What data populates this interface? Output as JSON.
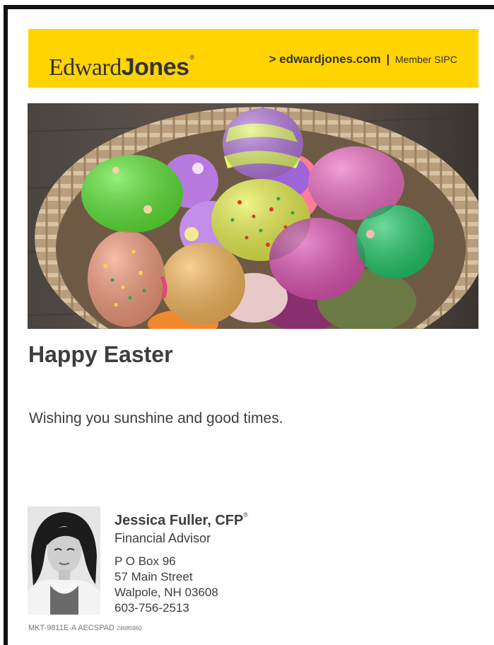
{
  "header": {
    "logo_edward": "Edward",
    "logo_jones": "Jones",
    "logo_mark": "®",
    "link_prefix": ">",
    "link_text": "edwardjones.com",
    "separator": "|",
    "member_text": "Member SIPC",
    "bar_color": "#FFD400"
  },
  "hero": {
    "icon": "easter-eggs-basket-photo"
  },
  "content": {
    "headline": "Happy Easter",
    "message": "Wishing you sunshine and good times."
  },
  "advisor": {
    "name": "Jessica Fuller, CFP",
    "name_mark": "®",
    "title": "Financial Advisor",
    "address_lines": [
      "P O Box 96",
      "57 Main Street",
      "Walpole, NH 03608",
      "603-756-2513"
    ]
  },
  "footer": {
    "code": "MKT-9811E-A AECSPAD",
    "id": "24685960"
  }
}
